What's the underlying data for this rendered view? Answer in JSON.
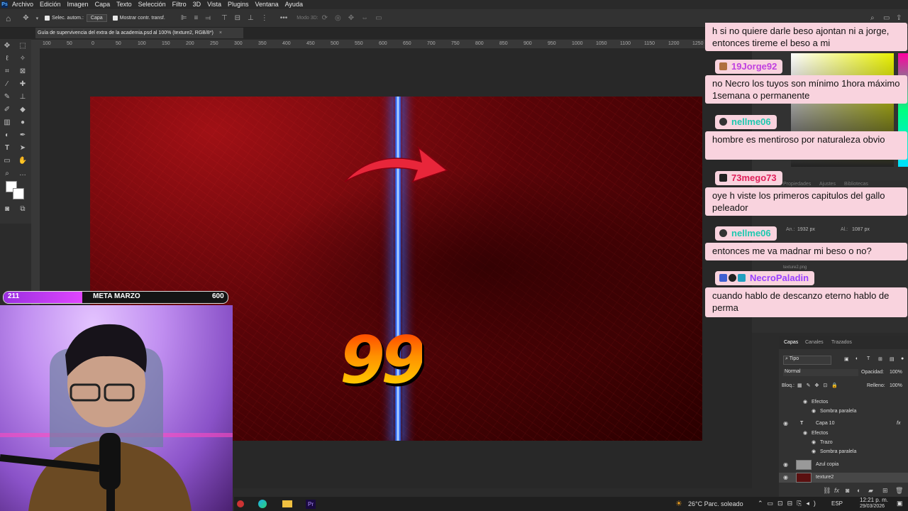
{
  "menubar": {
    "logo": "Ps",
    "items": [
      "Archivo",
      "Edición",
      "Imagen",
      "Capa",
      "Texto",
      "Selección",
      "Filtro",
      "3D",
      "Vista",
      "Plugins",
      "Ventana",
      "Ayuda"
    ]
  },
  "options": {
    "auto_select_label": "Selec. autom.:",
    "auto_select_value": "Capa",
    "show_transform_label": "Mostrar contr. transf.",
    "mode3d_label": "Modo 3D:"
  },
  "document": {
    "tab_title": "Guía de supervivencia del extra de la academia.psd al 100% (texture2, RGB/8*)",
    "close": "×"
  },
  "ruler": {
    "ticks": [
      "100",
      "50",
      "0",
      "50",
      "100",
      "150",
      "200",
      "250",
      "300",
      "350",
      "400",
      "450",
      "500",
      "550",
      "600",
      "650",
      "700",
      "750",
      "800",
      "850",
      "900",
      "950",
      "1000",
      "1050",
      "1100",
      "1150",
      "1200",
      "1250"
    ]
  },
  "canvas": {
    "number": "99"
  },
  "chat": [
    {
      "user": "",
      "text": "h si no quiere darle beso ajontan ni a jorge, entonces tireme el beso a mi",
      "name_color": ""
    },
    {
      "user": "19Jorge92",
      "text": "no Necro los tuyos son mínimo 1hora máximo 1semana o permanente",
      "name_color": "#c040e0"
    },
    {
      "user": "nellme06",
      "text": "hombre es mentiroso por naturaleza obvio",
      "name_color": "#1ec8b0"
    },
    {
      "user": "73mego73",
      "text": "oye h viste los primeros capitulos del gallo peleador",
      "name_color": "#e0205a"
    },
    {
      "user": "nellme06",
      "text": "entonces me va madnar mi beso o no?",
      "name_color": "#1ec8b0"
    },
    {
      "user": "NecroPaladin",
      "text": "cuando hablo de descanzo eterno hablo de perma",
      "name_color": "#9a40ff"
    }
  ],
  "panels": {
    "props_tabs": [
      "Propiedades",
      "Ajustes",
      "Bibliotecas"
    ],
    "w_label": "An.:",
    "w_value": "1932 px",
    "h_label": "Al.:",
    "h_value": "1087 px",
    "layer_small": "texture2.png"
  },
  "layers": {
    "tabs": [
      "Capas",
      "Canales",
      "Trazados"
    ],
    "filter": "Tipo",
    "blend": "Normal",
    "opacity_label": "Opacidad:",
    "opacity_value": "100%",
    "lock_label": "Bloq.:",
    "fill_label": "Relleno:",
    "fill_value": "100%",
    "rows": [
      {
        "label": "Efectos",
        "indent": 1
      },
      {
        "label": "Sombra paralela",
        "indent": 2
      },
      {
        "label": "Capa 10",
        "indent": 0,
        "fx": "fx"
      },
      {
        "label": "Efectos",
        "indent": 1
      },
      {
        "label": "Trazo",
        "indent": 2
      },
      {
        "label": "Sombra paralela",
        "indent": 2
      },
      {
        "label": "Azul copia",
        "indent": 0
      },
      {
        "label": "texture2",
        "indent": 0
      }
    ]
  },
  "goal": {
    "current": "211",
    "label": "META MARZO",
    "target": "600",
    "progress": 0.35
  },
  "taskbar": {
    "weather": "26°C  Parc. soleado",
    "lang": "ESP",
    "time": "12:21 p. m.",
    "date": "29/03/2026"
  }
}
